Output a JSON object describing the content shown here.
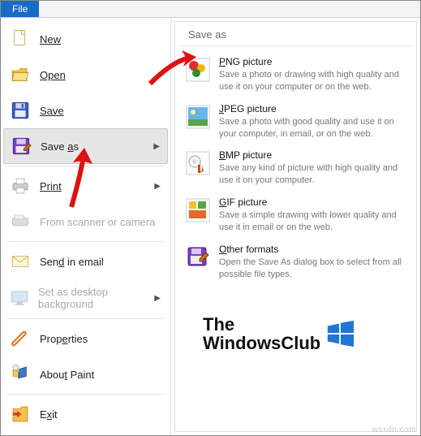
{
  "tab": {
    "file": "File"
  },
  "menu": {
    "new": "New",
    "open": "Open",
    "save": "Save",
    "save_as": "Save as",
    "print": "Print",
    "scanner": "From scanner or camera",
    "send": "Send in email",
    "desktop_bg": "Set as desktop background",
    "properties": "Properties",
    "about": "About Paint",
    "exit": "Exit"
  },
  "right": {
    "header": "Save as",
    "opts": {
      "png_title": "PNG picture",
      "png_desc": "Save a photo or drawing with high quality and use it on your computer or on the web.",
      "jpeg_title": "JPEG picture",
      "jpeg_desc": "Save a photo with good quality and use it on your computer, in email, or on the web.",
      "bmp_title": "BMP picture",
      "bmp_desc": "Save any kind of picture with high quality and use it on your computer.",
      "gif_title": "GIF picture",
      "gif_desc": "Save a simple drawing with lower quality and use it in email or on the web.",
      "other_title": "Other formats",
      "other_desc": "Open the Save As dialog box to select from all possible file types."
    }
  },
  "logo": {
    "line1": "The",
    "line2": "WindowsClub"
  },
  "watermark": "wsxdn.com"
}
